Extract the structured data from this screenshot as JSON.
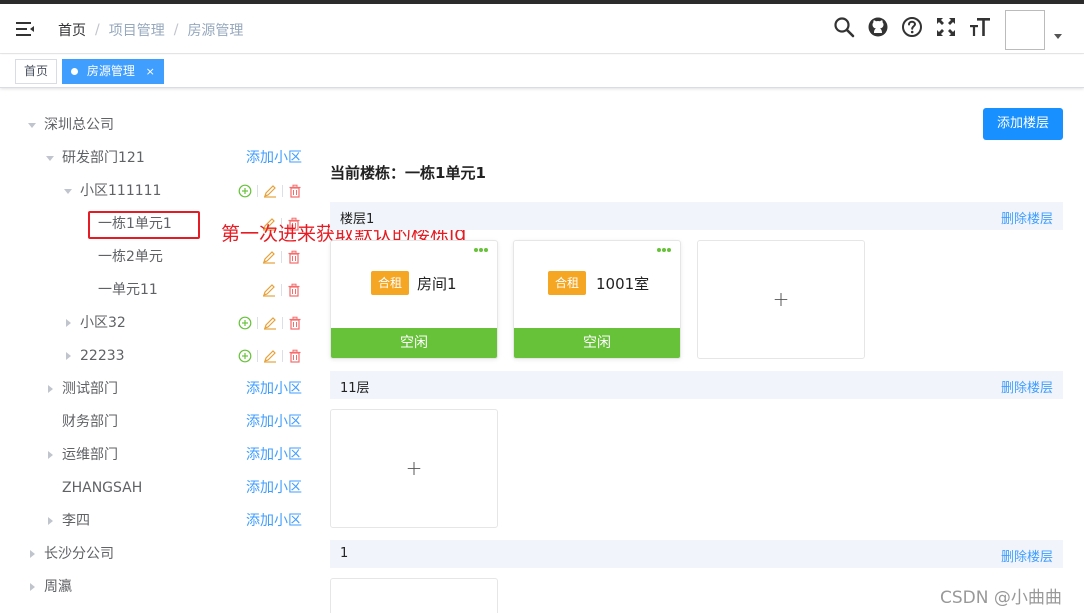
{
  "breadcrumb": [
    "首页",
    "项目管理",
    "房源管理"
  ],
  "tags": [
    {
      "label": "首页"
    },
    {
      "label": "房源管理",
      "close": "×"
    }
  ],
  "tree": {
    "root1": "深圳总公司",
    "dept_rd": "研发部门121",
    "community_1": "小区111111",
    "building_1": "一栋1单元1",
    "building_2": "一栋2单元",
    "building_3": "一单元11",
    "community_2": "小区32",
    "community_3": "22233",
    "dept_test": "测试部门",
    "dept_finance": "财务部门",
    "dept_ops": "运维部门",
    "dept_zhang": "ZHANGSAH",
    "dept_li": "李四",
    "root2": "长沙分公司",
    "root3": "周瀛",
    "add_community": "添加小区"
  },
  "annotation": "第一次进来获取默认的楼栋id",
  "main": {
    "add_floor_button": "添加楼层",
    "current_building": "当前楼栋：一栋1单元1",
    "delete_floor": "删除楼层",
    "floors": [
      {
        "name": "楼层1",
        "rooms": [
          {
            "badge": "合租",
            "name": "房间1",
            "status": "空闲"
          },
          {
            "badge": "合租",
            "name": "1001室",
            "status": "空闲"
          }
        ]
      },
      {
        "name": "11层",
        "rooms": []
      },
      {
        "name": "1",
        "rooms": []
      }
    ],
    "add_room_symbol": "+"
  },
  "watermark": "CSDN @小曲曲",
  "colors": {
    "primary": "#409eff",
    "button": "#1890ff",
    "status_free": "#67c23a",
    "badge": "#f5a623",
    "annotation": "#e51c23"
  }
}
